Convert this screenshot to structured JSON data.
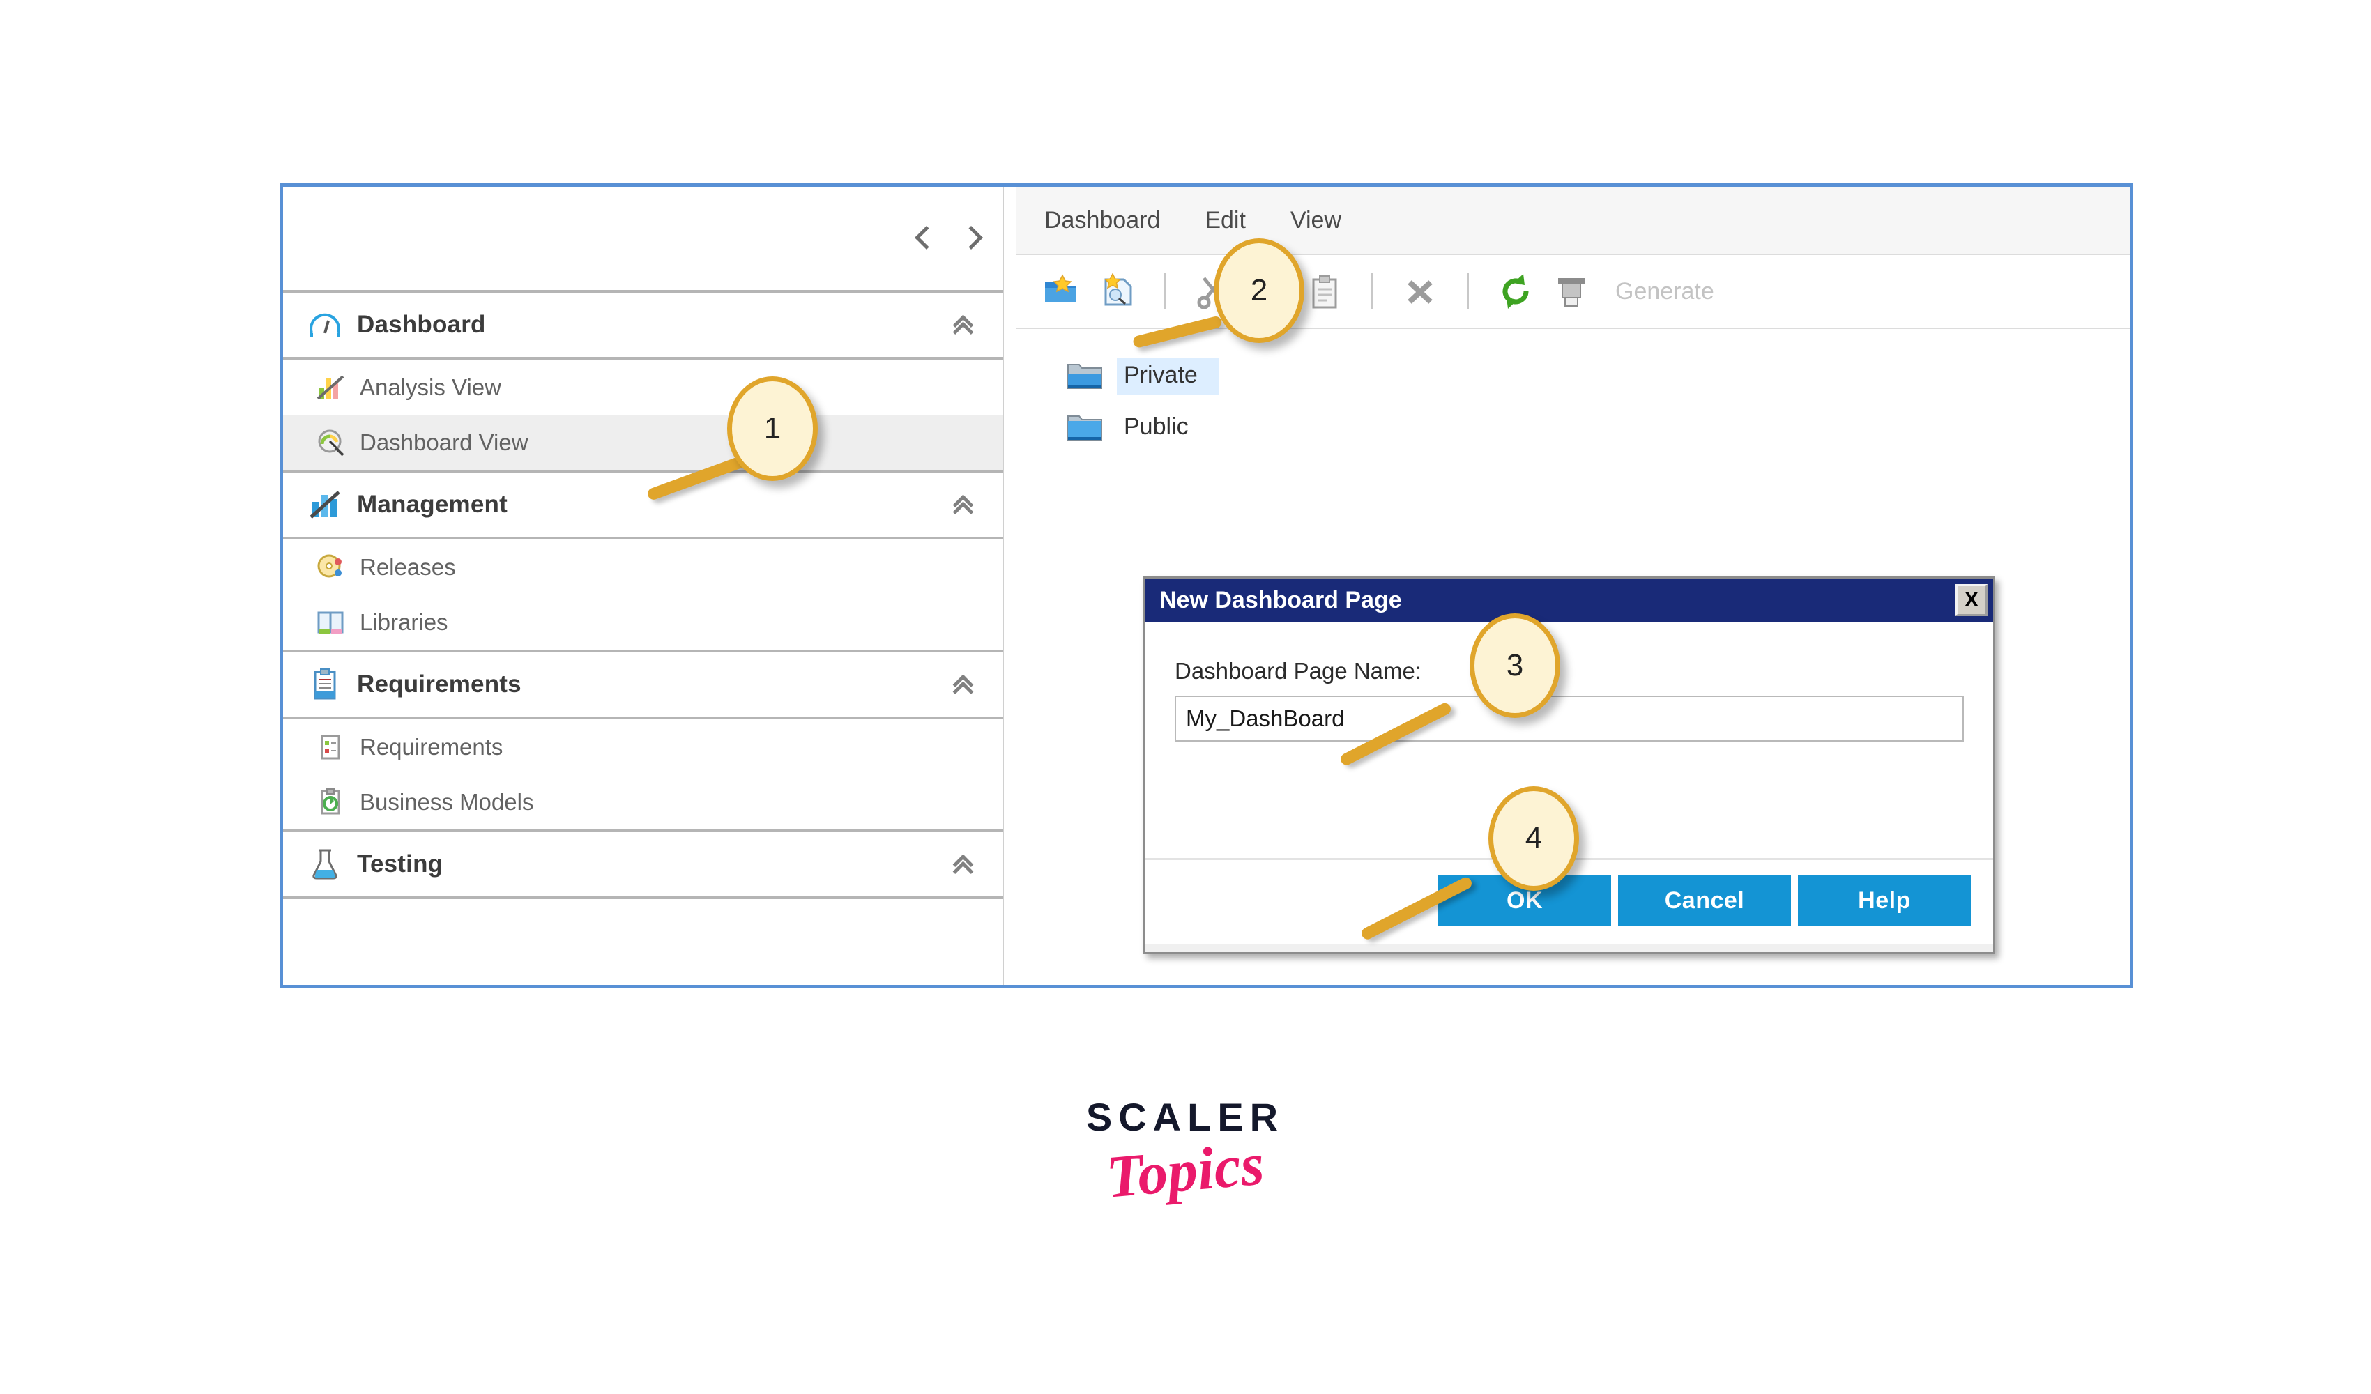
{
  "app": {
    "left_panel": {
      "nav_prev_icon": "chevron-left-icon",
      "nav_next_icon": "chevron-right-icon",
      "groups": [
        {
          "icon": "dashboard-gauge-icon",
          "label": "Dashboard",
          "collapse_icon": "double-chevron-up-icon",
          "items": [
            {
              "icon": "analysis-view-icon",
              "label": "Analysis View",
              "selected": false
            },
            {
              "icon": "dashboard-view-icon",
              "label": "Dashboard View",
              "selected": true
            }
          ]
        },
        {
          "icon": "management-bars-icon",
          "label": "Management",
          "collapse_icon": "double-chevron-up-icon",
          "items": [
            {
              "icon": "releases-icon",
              "label": "Releases",
              "selected": false
            },
            {
              "icon": "libraries-icon",
              "label": "Libraries",
              "selected": false
            }
          ]
        },
        {
          "icon": "requirements-clipboard-icon",
          "label": "Requirements",
          "collapse_icon": "double-chevron-up-icon",
          "items": [
            {
              "icon": "requirement-doc-icon",
              "label": "Requirements",
              "selected": false
            },
            {
              "icon": "business-models-icon",
              "label": "Business Models",
              "selected": false
            }
          ]
        },
        {
          "icon": "testing-flask-icon",
          "label": "Testing",
          "collapse_icon": "double-chevron-up-icon",
          "items": []
        }
      ]
    },
    "right_panel": {
      "menubar": [
        {
          "label": "Dashboard"
        },
        {
          "label": "Edit"
        },
        {
          "label": "View"
        }
      ],
      "toolbar": {
        "buttons": [
          {
            "icon": "new-dashboard-folder-icon",
            "enabled": true
          },
          {
            "icon": "new-dashboard-page-icon",
            "enabled": true
          },
          {
            "icon": "cut-scissors-icon",
            "enabled": false
          },
          {
            "icon": "copy-icon",
            "enabled": false
          },
          {
            "icon": "paste-clipboard-icon",
            "enabled": false
          },
          {
            "icon": "delete-x-icon",
            "enabled": false
          },
          {
            "icon": "refresh-icon",
            "enabled": true
          },
          {
            "icon": "generate-printer-icon",
            "enabled": false
          }
        ],
        "generate_label": "Generate"
      },
      "tree": [
        {
          "icon": "folder-icon",
          "label": "Private",
          "selected": true
        },
        {
          "icon": "folder-icon",
          "label": "Public",
          "selected": false
        }
      ]
    },
    "dialog": {
      "title": "New Dashboard Page",
      "close_icon": "close-x-icon",
      "close_label": "X",
      "field_label": "Dashboard Page Name:",
      "field_value": "My_DashBoard",
      "field_placeholder": "",
      "buttons": [
        {
          "label": "OK"
        },
        {
          "label": "Cancel"
        },
        {
          "label": "Help"
        }
      ]
    },
    "callouts": [
      {
        "number": "1"
      },
      {
        "number": "2"
      },
      {
        "number": "3"
      },
      {
        "number": "4"
      }
    ]
  },
  "logo": {
    "top_text": "SCALER",
    "bottom_text": "Topics"
  },
  "colors": {
    "frame_border": "#5890d5",
    "dialog_title_bg": "#192a78",
    "dialog_button_bg": "#1494d4",
    "selection_bg": "#ddeeff",
    "nav_selected_bg": "#eeeeee",
    "callout_fill": "#fdf3d4",
    "callout_border": "#e0a52b",
    "logo_dark": "#14182b",
    "logo_pink": "#ea1a6b"
  }
}
